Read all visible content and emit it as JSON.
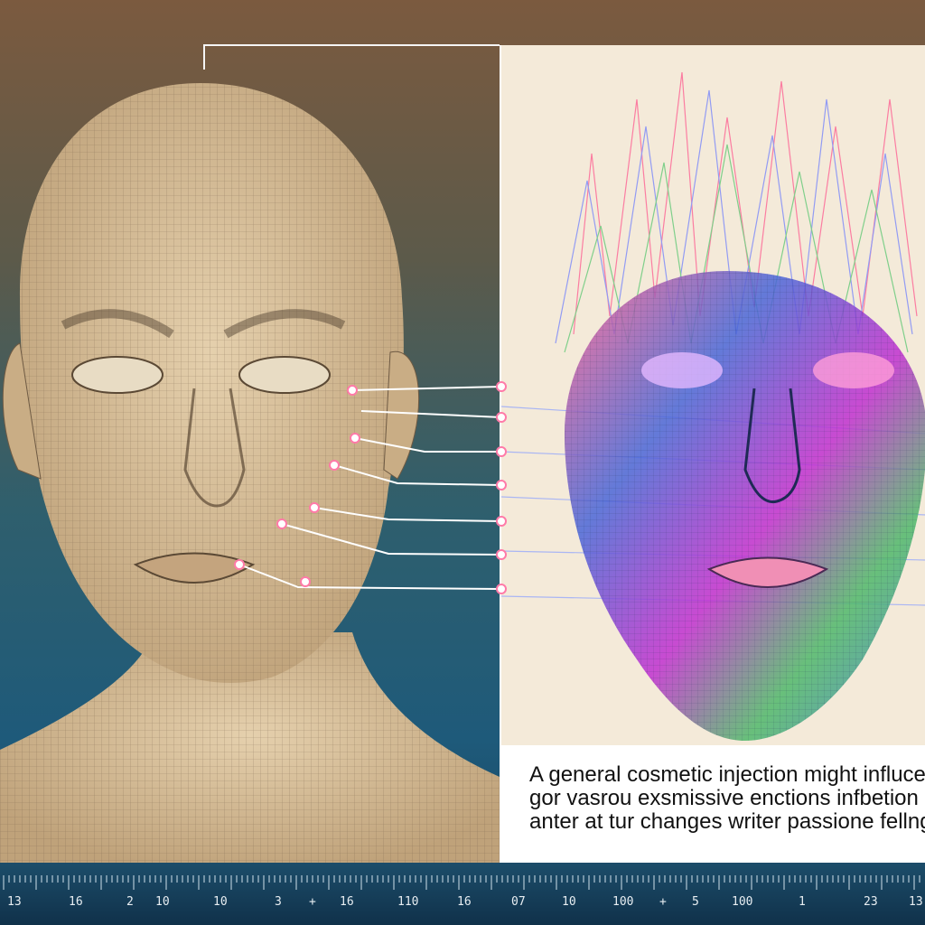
{
  "caption": {
    "line1": "A general cosmetic injection might influce",
    "line2": "gor vasrou exsmissive enctions infbetion sunt",
    "line3": "anter at tur changes writer passione fellngs"
  },
  "scale": {
    "labels": [
      "13",
      "16",
      "2",
      "10",
      "10",
      "3",
      "+",
      "16",
      "110",
      "16",
      "07",
      "10",
      "100",
      "+",
      "5",
      "100",
      "1",
      "23",
      "13"
    ]
  },
  "colors": {
    "background_top": "#7b5a3f",
    "background_bottom": "#173f5c",
    "mesh_face": "#d8c29f",
    "callout_dot": "#ff7aa8"
  }
}
